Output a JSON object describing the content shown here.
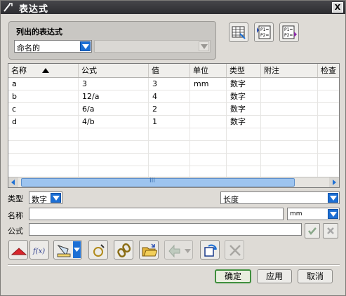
{
  "window": {
    "title": "表达式",
    "close_label": "X"
  },
  "list_group": {
    "label": "列出的表达式",
    "filter": {
      "value": "命名的"
    },
    "secondary_filter": {
      "value": ""
    }
  },
  "table": {
    "columns": [
      "名称",
      "公式",
      "值",
      "单位",
      "类型",
      "附注",
      "检查"
    ],
    "rows": [
      [
        "a",
        "3",
        "3",
        "mm",
        "数字",
        "",
        ""
      ],
      [
        "b",
        "12/a",
        "4",
        "",
        "数字",
        "",
        ""
      ],
      [
        "c",
        "6/a",
        "2",
        "",
        "数字",
        "",
        ""
      ],
      [
        "d",
        "4/b",
        "1",
        "",
        "数字",
        "",
        ""
      ]
    ],
    "scroll_grip": "III"
  },
  "type_row": {
    "label": "类型",
    "type_value": "数字",
    "dimension_value": "长度"
  },
  "name_row": {
    "label": "名称",
    "value": "",
    "unit_value": "mm"
  },
  "formula_row": {
    "label": "公式",
    "value": ""
  },
  "buttons": {
    "ok": "确定",
    "apply": "应用",
    "cancel": "取消"
  },
  "toolbar_icons": [
    "triangle-up-icon",
    "function-icon",
    "measure-icon",
    "expression-icon",
    "link-icon",
    "open-folder-icon",
    "import-icon",
    "refresh-icon",
    "delete-icon"
  ],
  "colors": {
    "title_bar": "#3a3a3e",
    "dropdown_arrow": "#1c6fd4",
    "scroll_thumb": "#9dc4ef",
    "ok_border": "#3f8f3d"
  }
}
